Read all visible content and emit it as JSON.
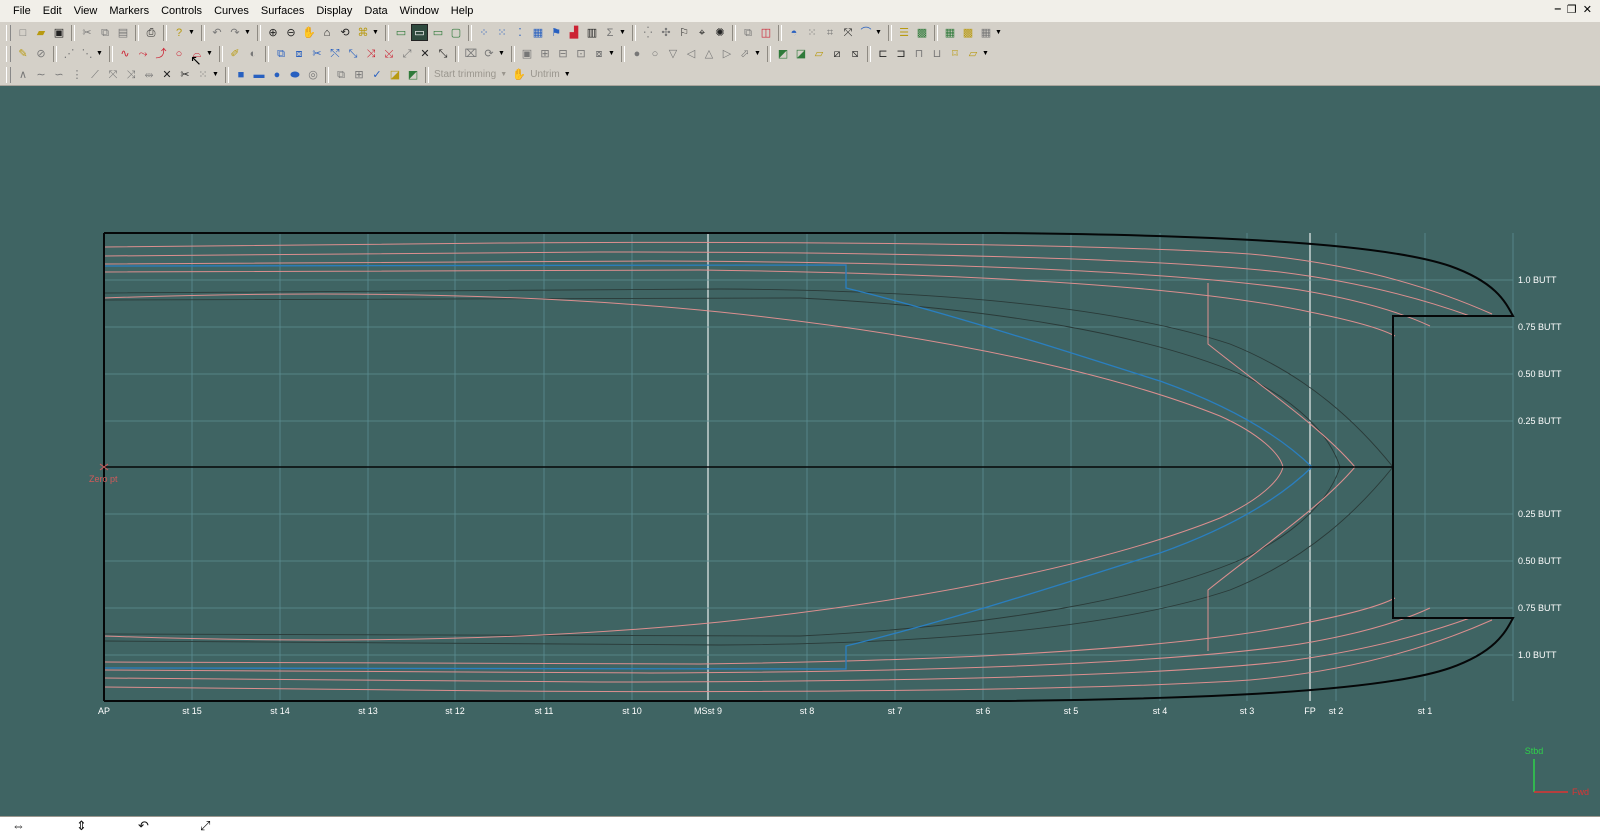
{
  "menu": [
    "File",
    "Edit",
    "View",
    "Markers",
    "Controls",
    "Curves",
    "Surfaces",
    "Display",
    "Data",
    "Window",
    "Help"
  ],
  "window_controls": {
    "minimize": "‒",
    "restore": "❐",
    "close": "✕"
  },
  "toolbar3": {
    "start_trimming": "Start trimming",
    "untrim": "Untrim"
  },
  "drawing": {
    "zero_point_label": "Zero pt",
    "stations": [
      "AP",
      "st 15",
      "st 14",
      "st 13",
      "st 12",
      "st 11",
      "st 10",
      "MSst 9",
      "st 8",
      "st 7",
      "st 6",
      "st 5",
      "st 4",
      "st 3",
      "FP",
      "st 2",
      "st 1"
    ],
    "buttocks_top": [
      "1.0 BUTT",
      "0.75 BUTT",
      "0.50 BUTT",
      "0.25 BUTT"
    ],
    "buttocks_bottom": [
      "0.25 BUTT",
      "0.50 BUTT",
      "0.75 BUTT",
      "1.0 BUTT"
    ],
    "axis_stbd": "Stbd",
    "axis_fwd": "Fwd",
    "colors": {
      "background": "#3f6463",
      "grid": "#5c8e92",
      "outline": "#050708",
      "waterline": "#dc8f8f",
      "blue_curve": "#2a7fc0",
      "faint_curve": "#2a3a38",
      "station_highlight": "#e8eeee",
      "label": "#ffffff",
      "zero_point": "#d05a5a"
    }
  },
  "status_icons": [
    "pan-horizontal-icon",
    "pan-vertical-icon",
    "rotate-icon",
    "expand-icon"
  ],
  "status_glyphs": [
    "⇔",
    "⇕",
    "↶",
    "⤢"
  ]
}
